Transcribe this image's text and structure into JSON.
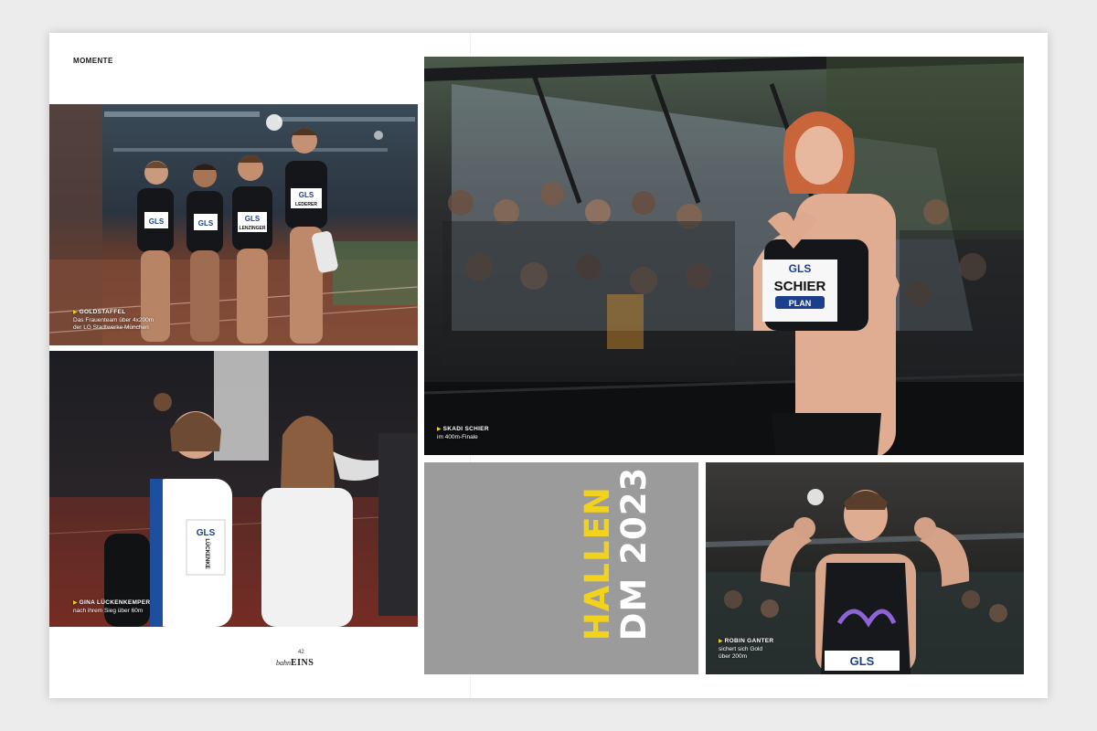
{
  "header": {
    "section": "MOMENTE"
  },
  "photos": {
    "relay": {
      "caption_name": "GOLDSTAFFEL",
      "caption_line1": "Das Frauenteam über 4x200m",
      "caption_line2": "der LG Stadtwerke München",
      "bibs": [
        "GLS",
        "GLS",
        "GLS",
        "GLS"
      ],
      "bib_names": [
        "LENZINGER",
        "LEDERER"
      ]
    },
    "gina": {
      "caption_name": "GINA LÜCKENKEMPER",
      "caption_line1": "nach ihrem Sieg über 60m",
      "bib": "GLS",
      "bib_name": "LÜCKENKE"
    },
    "skadi": {
      "caption_name": "SKADI SCHIER",
      "caption_line1": "im 400m-Finale",
      "bib": "GLS",
      "bib_name": "SCHIER",
      "sponsor": "PLAN"
    },
    "robin": {
      "caption_name": "ROBIN GANTER",
      "caption_line1": "sichert sich Gold",
      "caption_line2": "über 200m",
      "bib": "GLS"
    }
  },
  "panel": {
    "title_line1": "HALLEN",
    "title_line2": "DM 2023"
  },
  "footer": {
    "page_number": "42",
    "brand_part1": "bahn",
    "brand_part2": "EINS"
  },
  "colors": {
    "accent_yellow": "#f2d21b",
    "panel_grey": "#9b9b9b"
  },
  "icons": [
    "play-triangle-icon"
  ]
}
